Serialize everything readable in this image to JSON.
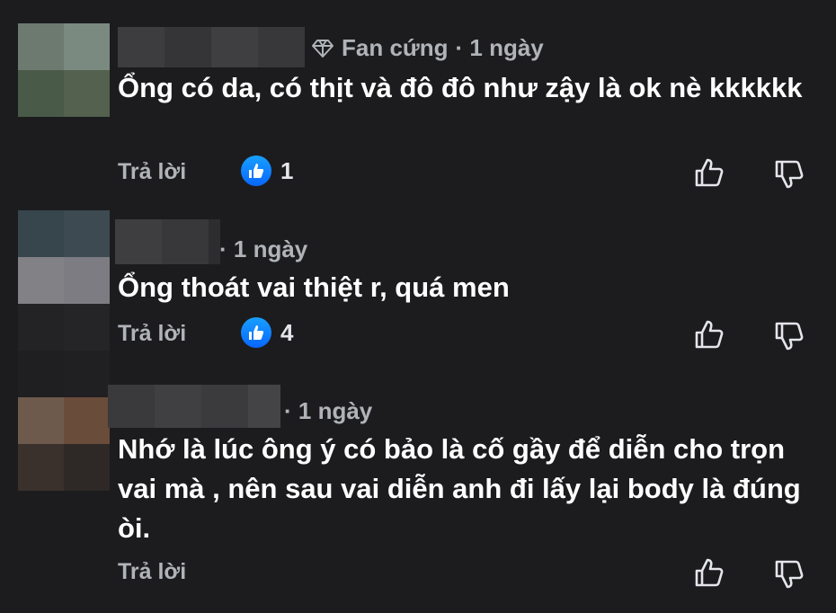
{
  "comments": [
    {
      "badge_label": "Fan cứng",
      "time": "· 1 ngày",
      "text": "Ổng có da, có thịt và đô đô như zậy là ok nè kkkkkk",
      "reply_label": "Trả lời",
      "like_count": "1"
    },
    {
      "time": "· 1 ngày",
      "text": "Ổng thoát vai thiệt r, quá men",
      "reply_label": "Trả lời",
      "like_count": "4"
    },
    {
      "time": "· 1 ngày",
      "text": "Nhớ là lúc ông ý có bảo là cố gầy để diễn cho trọn vai mà , nên sau vai diễn anh đi lấy lại body là đúng òi.",
      "reply_label": "Trả lời"
    }
  ],
  "icons": {
    "badge": "diamond-icon",
    "like_reaction": "thumbs-up-icon",
    "upvote": "thumbs-up-outline-icon",
    "downvote": "thumbs-down-outline-icon"
  },
  "colors": {
    "background": "#1c1c1e",
    "text_primary": "#ffffff",
    "text_secondary": "#b0b3b8",
    "like_blue": "#0866ff"
  }
}
